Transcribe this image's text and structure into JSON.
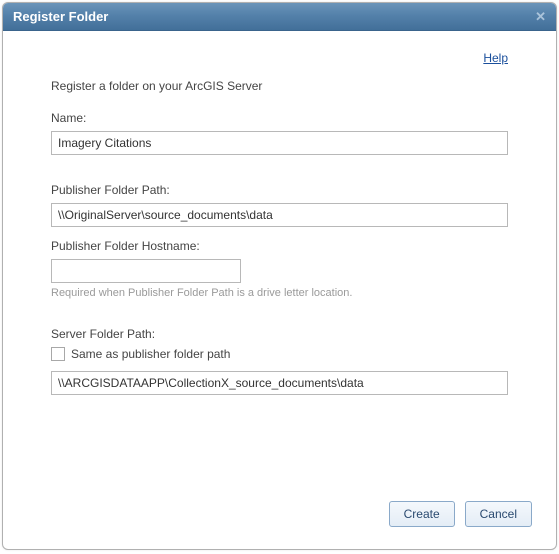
{
  "dialog": {
    "title": "Register Folder",
    "help_label": "Help",
    "intro": "Register a folder on your ArcGIS Server",
    "name_label": "Name:",
    "name_value": "Imagery Citations",
    "pub_path_label": "Publisher Folder Path:",
    "pub_path_value": "\\\\OriginalServer\\source_documents\\data",
    "pub_host_label": "Publisher Folder Hostname:",
    "pub_host_value": "",
    "pub_host_hint": "Required when Publisher Folder Path is a drive letter location.",
    "server_path_label": "Server Folder Path:",
    "same_as_label": "Same as publisher folder path",
    "same_as_checked": false,
    "server_path_value": "\\\\ARCGISDATAAPP\\CollectionX_source_documents\\data",
    "create_label": "Create",
    "cancel_label": "Cancel"
  }
}
